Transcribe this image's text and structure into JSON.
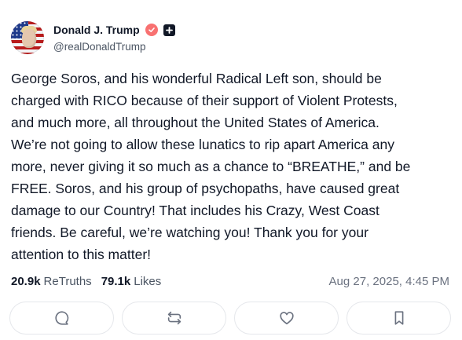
{
  "post": {
    "author": {
      "display_name": "Donald J. Trump",
      "handle": "@realDonaldTrump",
      "verified_icon": "verified-check-icon",
      "badge_icon": "plus-badge-icon",
      "avatar_icon": "profile-avatar"
    },
    "body": "George Soros, and his wonderful Radical Left son, should be\ncharged with RICO because of their support of Violent Protests,\nand much more, all throughout the United States of America.\nWe’re not going to allow these lunatics to rip apart America any\nmore, never giving it so much as a chance to “BREATHE,” and be\nFREE. Soros, and his group of psychopaths, have caused great\ndamage to our Country! That includes his Crazy, West Coast\nfriends. Be careful, we’re watching you! Thank you for your\nattention to this matter!",
    "stats": {
      "retruths_count": "20.9k",
      "retruths_label": "ReTruths",
      "likes_count": "79.1k",
      "likes_label": "Likes"
    },
    "timestamp": "Aug 27, 2025, 4:45 PM",
    "actions": [
      {
        "icon": "reply-icon"
      },
      {
        "icon": "retruth-icon"
      },
      {
        "icon": "like-heart-icon"
      },
      {
        "icon": "bookmark-icon"
      }
    ],
    "colors": {
      "verified": "#f87171",
      "text_primary": "#111827",
      "text_secondary": "#4b5563",
      "icon": "#6b7280",
      "border": "#e5e7eb"
    }
  }
}
